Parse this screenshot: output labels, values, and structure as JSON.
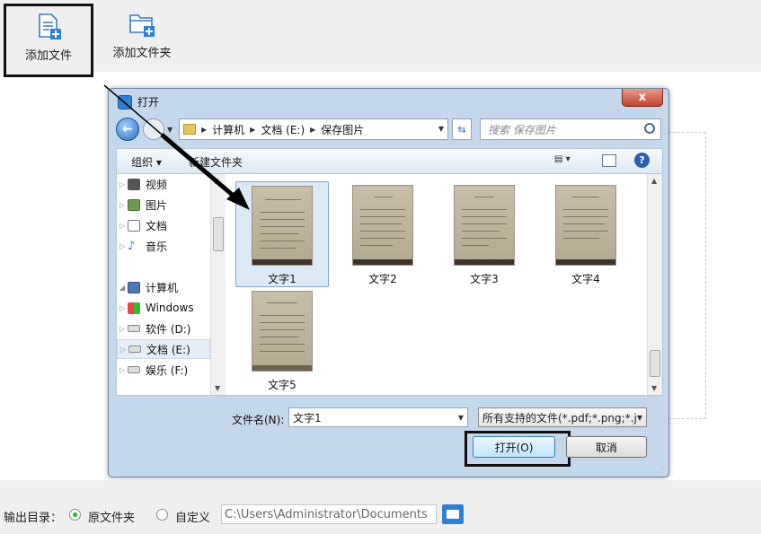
{
  "toolbar": {
    "add_file_label": "添加文件",
    "add_folder_label": "添加文件夹"
  },
  "dialog": {
    "title": "打开",
    "close_label": "x",
    "address": {
      "crumbs": [
        "计算机",
        "文档 (E:)",
        "保存图片"
      ]
    },
    "search_placeholder": "搜索 保存图片",
    "organize_label": "组织 ▾",
    "new_folder_label": "新建文件夹",
    "help_label": "?",
    "nav_items": [
      "视频",
      "图片",
      "文档",
      "音乐",
      "计算机",
      "Windows",
      "软件 (D:)",
      "文档 (E:)",
      "娱乐 (F:)"
    ],
    "files": [
      "文字1",
      "文字2",
      "文字3",
      "文字4",
      "文字5"
    ],
    "filename_label": "文件名(N):",
    "filename_value": "文字1",
    "filetype_value": "所有支持的文件(*.pdf;*.png;*.j",
    "open_label": "打开(O)",
    "cancel_label": "取消"
  },
  "output": {
    "label": "输出目录：",
    "option_original": "原文件夹",
    "option_custom": "自定义",
    "path_value": "C:\\Users\\Administrator\\Documents"
  },
  "colors": {
    "dialog_frame": "#c5d7ea",
    "selection": "#dce9f7",
    "accent": "#2f7fd4",
    "radio_checked": "#2eb82e"
  }
}
